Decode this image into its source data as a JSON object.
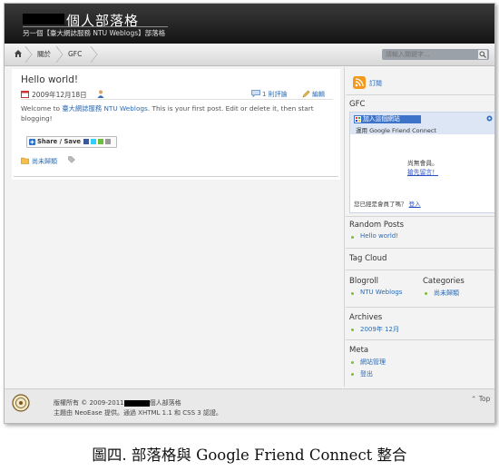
{
  "header": {
    "site_title": "個人部落格",
    "description": "另一個【臺大網誌服務 NTU Weblogs】部落格"
  },
  "nav": {
    "home_label": "關於",
    "crumb_label": "GFC",
    "search_placeholder": "請輸入關鍵字..."
  },
  "post": {
    "title": "Hello world!",
    "date": "2009年12月18日",
    "comments": "1 則評論",
    "edit": "編輯",
    "body_prefix": "Welcome to ",
    "body_link": "臺大網誌服務 NTU Weblogs",
    "body_suffix": ". This is your first post. Edit or delete it, then start blogging!",
    "share_label": "Share / Save",
    "category": "尚未歸類"
  },
  "sidebar": {
    "subscribe": "訂閱",
    "gfc_title": "GFC",
    "gfc_join": "加入這個網站",
    "gfc_sub": "運用 Google Friend Connect",
    "gfc_no_members": "尚無會員。",
    "gfc_be_first": "搶先留言！",
    "gfc_member_q": "您已經是會員了嗎？",
    "gfc_signin": "登入",
    "random_title": "Random Posts",
    "random_items": [
      "Hello world!"
    ],
    "tagcloud_title": "Tag Cloud",
    "blogroll_title": "Blogroll",
    "blogroll_items": [
      "NTU Weblogs"
    ],
    "categories_title": "Categories",
    "categories_items": [
      "尚未歸類"
    ],
    "archives_title": "Archives",
    "archives_items": [
      "2009年 12月"
    ],
    "meta_title": "Meta",
    "meta_items": [
      "網站管理",
      "登出"
    ]
  },
  "footer": {
    "line1_prefix": "版權所有 © 2009-2011",
    "line1_suffix": "個人部落格",
    "line2": "主題由 NeoEase 提供。通過 XHTML 1.1 和 CSS 3 認證。",
    "to_top": "Top"
  },
  "caption": "圖四. 部落格與 Google Friend Connect 整合",
  "colors": {
    "link": "#2a6bb5",
    "bullet": "#7bbf3a",
    "rss": "#f39a1e",
    "header_bg": "#1e1e1e"
  }
}
